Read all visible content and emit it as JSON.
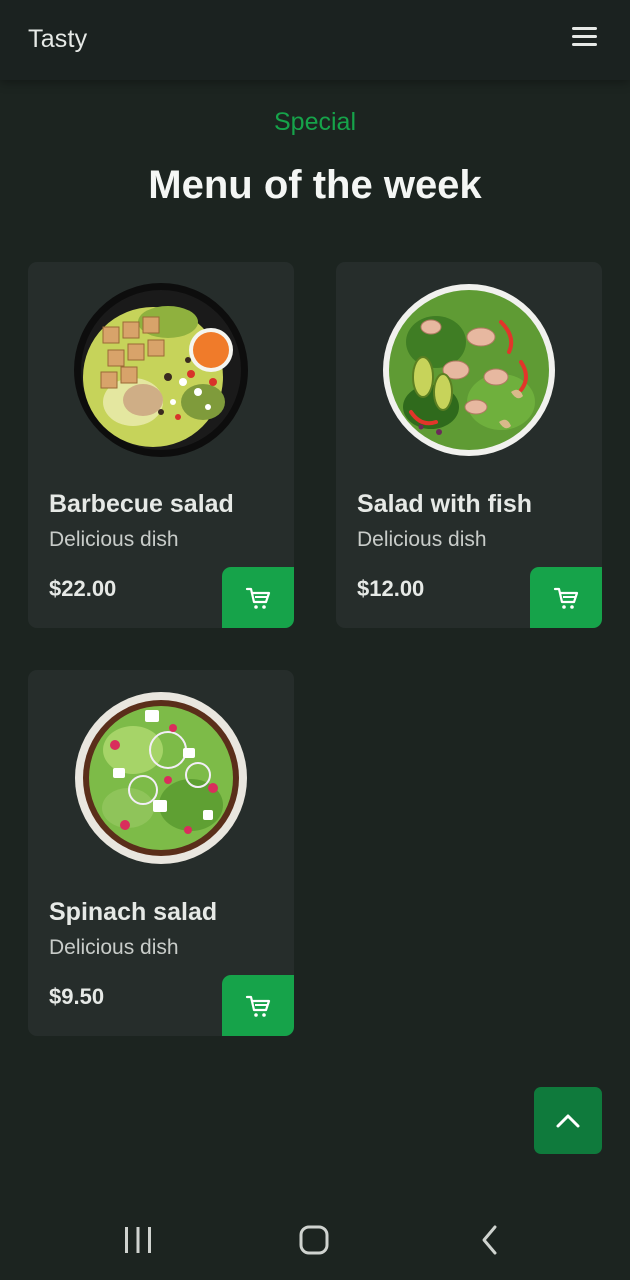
{
  "app": {
    "title": "Tasty"
  },
  "header": {
    "menu_icon": "hamburger-icon"
  },
  "section": {
    "tag": "Special",
    "title": "Menu of the week"
  },
  "dishes": [
    {
      "name": "Barbecue salad",
      "description": "Delicious dish",
      "price": "$22.00",
      "image": "barbecue-salad-image"
    },
    {
      "name": "Salad with fish",
      "description": "Delicious dish",
      "price": "$12.00",
      "image": "fish-salad-image"
    },
    {
      "name": "Spinach salad",
      "description": "Delicious dish",
      "price": "$9.50",
      "image": "spinach-salad-image"
    }
  ],
  "colors": {
    "accent": "#16a34a",
    "background": "#1c2420",
    "card": "#262d2b",
    "scroll_button": "#0f7a3c"
  },
  "icons": {
    "cart": "cart-icon",
    "scroll_top": "chevron-up-icon",
    "nav_recent": "recent-apps-icon",
    "nav_home": "home-icon",
    "nav_back": "back-icon"
  }
}
